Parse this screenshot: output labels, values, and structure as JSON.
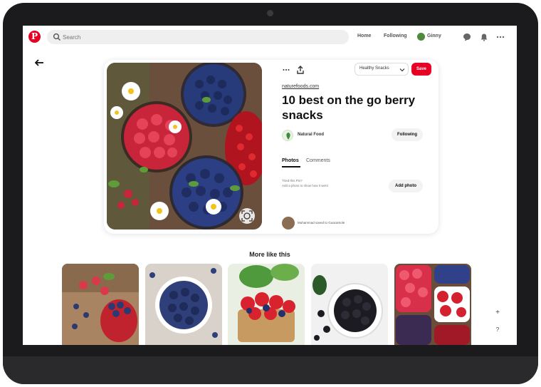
{
  "header": {
    "search_placeholder": "Search",
    "nav": {
      "home": "Home",
      "following": "Following",
      "user": "Ginny"
    }
  },
  "pin": {
    "board_select_label": "Healthy Snacks",
    "save_label": "Save",
    "source": "naturefoods.com",
    "title": "10 best on the go berry snacks",
    "author": "Natural Food",
    "following_label": "Following",
    "tabs": {
      "photos": "Photos",
      "comments": "Comments"
    },
    "tried_text": [
      "Tried this Pin?",
      "Add a photo to show how it went"
    ],
    "add_photo_label": "Add photo",
    "saver_text": "Muhammad saved to Guacamole"
  },
  "more_like_this": "More like this",
  "colors": {
    "accent": "#e60023"
  },
  "icons": {
    "logo": "pinterest-logo",
    "search": "search-icon",
    "chat": "chat-icon",
    "notifications": "bell-icon",
    "more": "more-icon",
    "back": "back-arrow-icon",
    "share": "share-icon",
    "lens": "lens-icon",
    "add": "plus-icon",
    "help": "help-icon"
  }
}
